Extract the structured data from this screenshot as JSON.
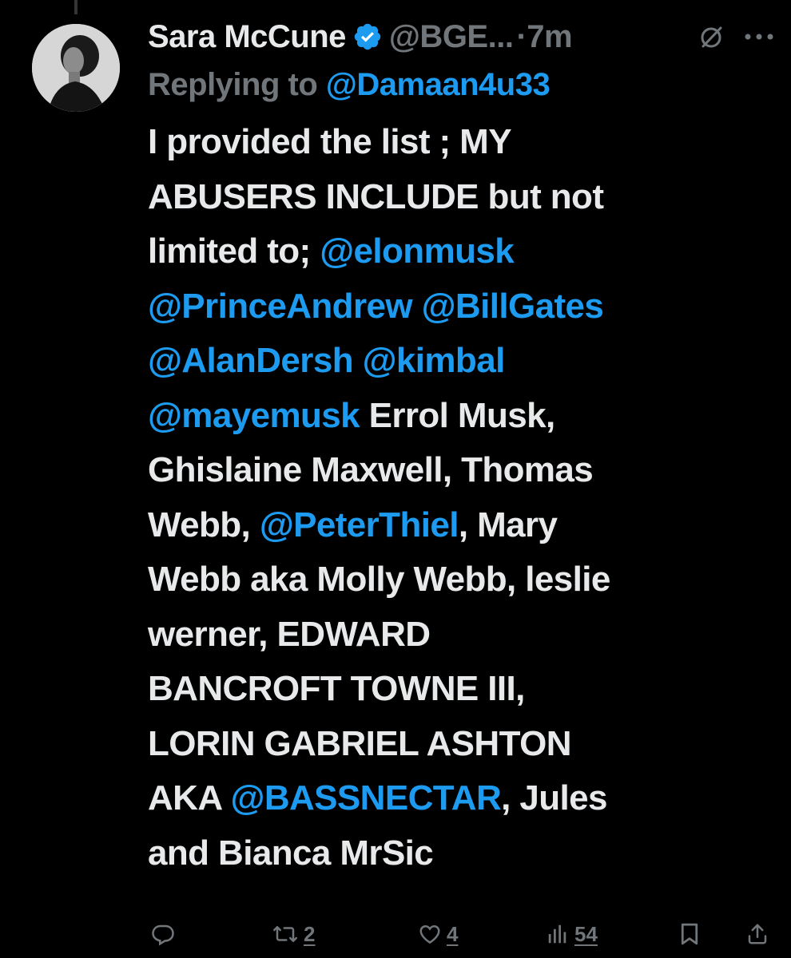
{
  "tweet": {
    "author_name": "Sara McCune",
    "handle": "@BGE...",
    "separator": "·",
    "time": "7m",
    "replying_prefix": "Replying to ",
    "replying_to": "@Damaan4u33",
    "body_lines": [
      [
        {
          "t": "I provided the list ; MY",
          "m": false
        }
      ],
      [
        {
          "t": "ABUSERS INCLUDE but not",
          "m": false
        }
      ],
      [
        {
          "t": "limited to; ",
          "m": false
        },
        {
          "t": "@elonmusk",
          "m": true
        }
      ],
      [
        {
          "t": "@PrinceAndrew",
          "m": true
        },
        {
          "t": " ",
          "m": false
        },
        {
          "t": "@BillGates",
          "m": true
        }
      ],
      [
        {
          "t": "@AlanDersh",
          "m": true
        },
        {
          "t": " ",
          "m": false
        },
        {
          "t": "@kimbal",
          "m": true
        }
      ],
      [
        {
          "t": "@mayemusk",
          "m": true
        },
        {
          "t": " Errol Musk,",
          "m": false
        }
      ],
      [
        {
          "t": "Ghislaine Maxwell, Thomas",
          "m": false
        }
      ],
      [
        {
          "t": "Webb, ",
          "m": false
        },
        {
          "t": "@PeterThiel",
          "m": true
        },
        {
          "t": ", Mary",
          "m": false
        }
      ],
      [
        {
          "t": "Webb aka Molly Webb, leslie",
          "m": false
        }
      ],
      [
        {
          "t": "werner, EDWARD",
          "m": false
        }
      ],
      [
        {
          "t": "BANCROFT TOWNE III,",
          "m": false
        }
      ],
      [
        {
          "t": "LORIN GABRIEL ASHTON",
          "m": false
        }
      ],
      [
        {
          "t": "AKA ",
          "m": false
        },
        {
          "t": "@BASSNECTAR",
          "m": true
        },
        {
          "t": ", Jules",
          "m": false
        }
      ],
      [
        {
          "t": "and Bianca MrSic",
          "m": false
        }
      ]
    ]
  },
  "actions": {
    "reply_count": "",
    "retweet_count": "2",
    "like_count": "4",
    "views_count": "54"
  },
  "icons": [
    "verified-badge-icon",
    "grok-icon",
    "more-icon",
    "reply-icon",
    "retweet-icon",
    "like-icon",
    "views-icon",
    "bookmark-icon",
    "share-icon"
  ],
  "colors": {
    "background": "#000000",
    "text": "#e7e9ea",
    "secondary": "#71767b",
    "accent": "#1d9bf0"
  }
}
